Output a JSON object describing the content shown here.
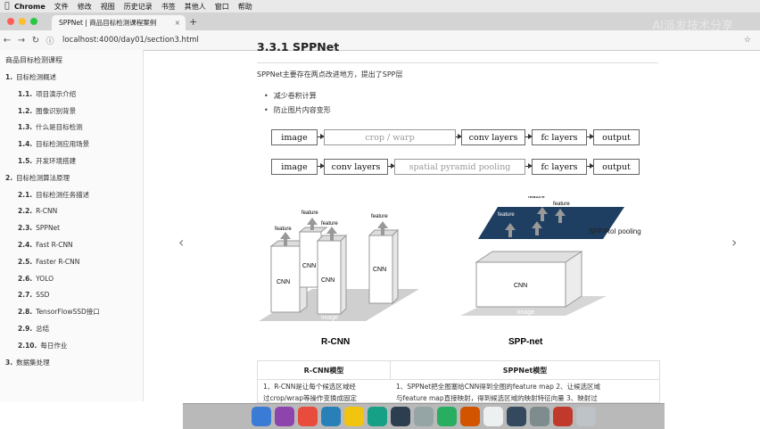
{
  "menubar": {
    "app": "Chrome",
    "items": [
      "文件",
      "修改",
      "视图",
      "历史记录",
      "书签",
      "其他人",
      "窗口",
      "帮助"
    ]
  },
  "tab": {
    "title": "SPPNet | 商品目标检测课程案例"
  },
  "address": {
    "url": "localhost:4000/day01/section3.html"
  },
  "sidebar": {
    "title": "商品目标检测课程",
    "items": [
      {
        "num": "1.",
        "label": "目标检测概述",
        "level": 1
      },
      {
        "num": "1.1.",
        "label": "项目演示介绍",
        "level": 2
      },
      {
        "num": "1.2.",
        "label": "图像识别背景",
        "level": 2
      },
      {
        "num": "1.3.",
        "label": "什么是目标检测",
        "level": 2
      },
      {
        "num": "1.4.",
        "label": "目标检测应用场景",
        "level": 2
      },
      {
        "num": "1.5.",
        "label": "开发环境搭建",
        "level": 2
      },
      {
        "num": "2.",
        "label": "目标检测算法原理",
        "level": 1
      },
      {
        "num": "2.1.",
        "label": "目标检测任务描述",
        "level": 2
      },
      {
        "num": "2.2.",
        "label": "R-CNN",
        "level": 2
      },
      {
        "num": "2.3.",
        "label": "SPPNet",
        "level": 2
      },
      {
        "num": "2.4.",
        "label": "Fast R-CNN",
        "level": 2
      },
      {
        "num": "2.5.",
        "label": "Faster R-CNN",
        "level": 2
      },
      {
        "num": "2.6.",
        "label": "YOLO",
        "level": 2
      },
      {
        "num": "2.7.",
        "label": "SSD",
        "level": 2
      },
      {
        "num": "2.8.",
        "label": "TensorFlowSSD接口",
        "level": 2
      },
      {
        "num": "2.9.",
        "label": "总结",
        "level": 2
      },
      {
        "num": "2.10.",
        "label": "每日作业",
        "level": 2
      },
      {
        "num": "3.",
        "label": "数据集处理",
        "level": 1
      }
    ]
  },
  "main": {
    "heading": "3.3.1 SPPNet",
    "intro": "SPPNet主要存在两点改进地方，提出了SPP层",
    "bullets": [
      "减少卷积计算",
      "防止图片内容变形"
    ],
    "flow1": [
      "image",
      "crop / warp",
      "conv layers",
      "fc layers",
      "output"
    ],
    "flow2": [
      "image",
      "conv layers",
      "spatial pyramid pooling",
      "fc layers",
      "output"
    ],
    "diagram": {
      "rcnn_caption": "R-CNN",
      "sppnet_caption": "SPP-net",
      "cnn_label": "CNN",
      "feature_label": "feature",
      "image_label": "image",
      "spp_label": "SPP/RoI pooling"
    },
    "table": {
      "headers": [
        "R-CNN模型",
        "SPPNet模型"
      ],
      "row1": [
        "1、R-CNN是让每个候选区域经",
        "1、SPPNet把全图塞给CNN得到全图的feature map 2、让候选区域"
      ],
      "row2": [
        "过crop/wrap等操作变换成固定",
        "与feature map直接映射，得到候选区域的映射特征向量 3、映射过"
      ]
    }
  },
  "watermark": "AI派发技术分享",
  "colors": {
    "accent": "#1e3e62",
    "arrow": "#888888"
  }
}
